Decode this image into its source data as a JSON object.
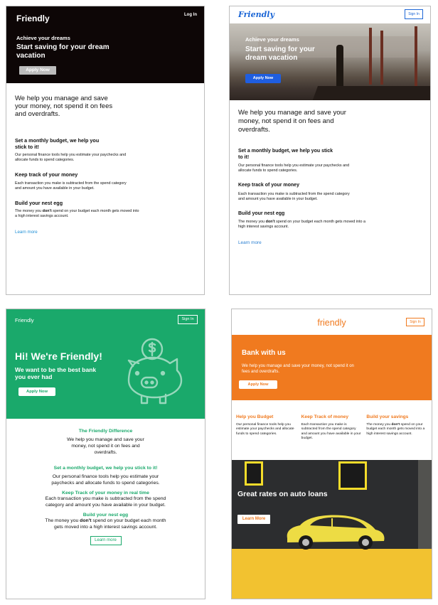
{
  "card1": {
    "brand": "Friendly",
    "login": "Log In",
    "hero": {
      "eyebrow": "Achieve your dreams",
      "headline": "Start saving for your dream vacation",
      "apply": "Apply Now"
    },
    "lead": "We help you manage and save your money, not spend it on fees and overdrafts.",
    "sections": [
      {
        "title": "Set a monthly budget, we help you stick to it!",
        "text": "Our personal finance tools help you estimate your paychecks and allocate funds to spend categories."
      },
      {
        "title": "Keep track of your money",
        "text": "Each transaction you make is subtracted from the spend category and amount you have available in your budget."
      },
      {
        "title": "Build your nest egg",
        "text_before": "The money you ",
        "text_bold": "don't",
        "text_after": " spend on your budget each month gets moved into a high interest savings account."
      }
    ],
    "learn_more": "Learn more"
  },
  "card2": {
    "brand": "Friendly",
    "signin": "Sign In",
    "hero": {
      "eyebrow": "Achieve your dreams",
      "headline": "Start saving for your dream vacation",
      "apply": "Apply Now"
    },
    "lead": "We help you manage and save your money, not spend it on fees and overdrafts.",
    "sections": [
      {
        "title": "Set a monthly budget, we help you stick to it!",
        "text": "Our personal finance tools help you estimate your paychecks and allocate funds to spend categories."
      },
      {
        "title": "Keep track of your money",
        "text": "Each transaction you make is subtracted from the spend category and amount you have available in your budget."
      },
      {
        "title": "Build your nest egg",
        "text_before": "The money you ",
        "text_bold": "don't",
        "text_after": " spend on your budget each month gets moved into a high interest savings account."
      }
    ],
    "learn_more": "Learn more",
    "accent": "#1f5ee0"
  },
  "card3": {
    "brand": "Friendly",
    "signin": "Sign In",
    "hero": {
      "title": "Hi! We're Friendly!",
      "subtitle": "We want to be the best bank you ever had",
      "apply": "Apply Now",
      "icon": "piggy-bank-icon"
    },
    "difference_title": "The Friendly Difference",
    "difference_text": "We help you manage and save your money, not spend it on fees and overdrafts.",
    "sections": [
      {
        "title": "Set a monthly budget, we help you stick to it!",
        "text": "Our personal finance tools help you estimate your paychecks and allocate funds to spend categories."
      },
      {
        "title": "Keep Track of your money in real time",
        "text": "Each transaction you make is subtracted from the spend category and amount you have available in your budget."
      },
      {
        "title": "Build your nest egg",
        "text_before": "The money you ",
        "text_bold": "don't",
        "text_after": " spend on your budget each month gets moved into a high interest savings account."
      }
    ],
    "learn_more": "Learn more",
    "accent": "#1aa96b"
  },
  "card4": {
    "brand": "friendly",
    "signin": "Sign In",
    "hero": {
      "title": "Bank with us",
      "text": "We help you manage and save your money, not spend it on fees and overdrafts.",
      "apply": "Apply Now"
    },
    "columns": [
      {
        "title": "Help you Budget",
        "text": "Our personal finance tools help you estimate your paychecks and allocate funds to spend categories."
      },
      {
        "title": "Keep Track of money",
        "text": "Each transaction you make is subtracted from the spend category and amount you have available in your budget."
      },
      {
        "title": "Build your savings",
        "text_before": "The money you ",
        "text_bold": "don't",
        "text_after": " spend on your budget each month gets moved into a high interest savings account."
      }
    ],
    "promo": {
      "title": "Great rates on auto loans",
      "learn_more": "Learn More"
    },
    "accent": "#f07a1f"
  }
}
